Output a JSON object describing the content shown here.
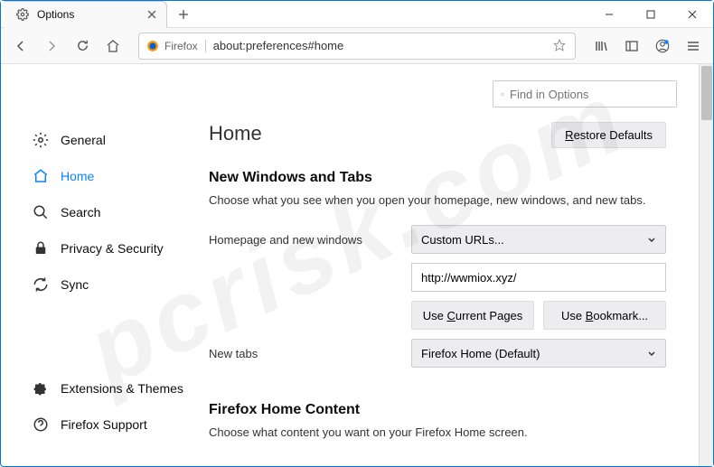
{
  "tab": {
    "title": "Options"
  },
  "urlbar": {
    "identity": "Firefox",
    "url": "about:preferences#home"
  },
  "search": {
    "placeholder": "Find in Options"
  },
  "sidebar": {
    "items": [
      {
        "label": "General"
      },
      {
        "label": "Home"
      },
      {
        "label": "Search"
      },
      {
        "label": "Privacy & Security"
      },
      {
        "label": "Sync"
      }
    ],
    "footer": [
      {
        "label": "Extensions & Themes"
      },
      {
        "label": "Firefox Support"
      }
    ]
  },
  "main": {
    "heading": "Home",
    "restore": "Restore Defaults",
    "section1": {
      "title": "New Windows and Tabs",
      "desc": "Choose what you see when you open your homepage, new windows, and new tabs.",
      "row1_label": "Homepage and new windows",
      "row1_select": "Custom URLs...",
      "row1_url": "http://wwmiox.xyz/",
      "btn_current": "Use Current Pages",
      "btn_bookmark": "Use Bookmark...",
      "row2_label": "New tabs",
      "row2_select": "Firefox Home (Default)"
    },
    "section2": {
      "title": "Firefox Home Content",
      "desc": "Choose what content you want on your Firefox Home screen."
    }
  }
}
